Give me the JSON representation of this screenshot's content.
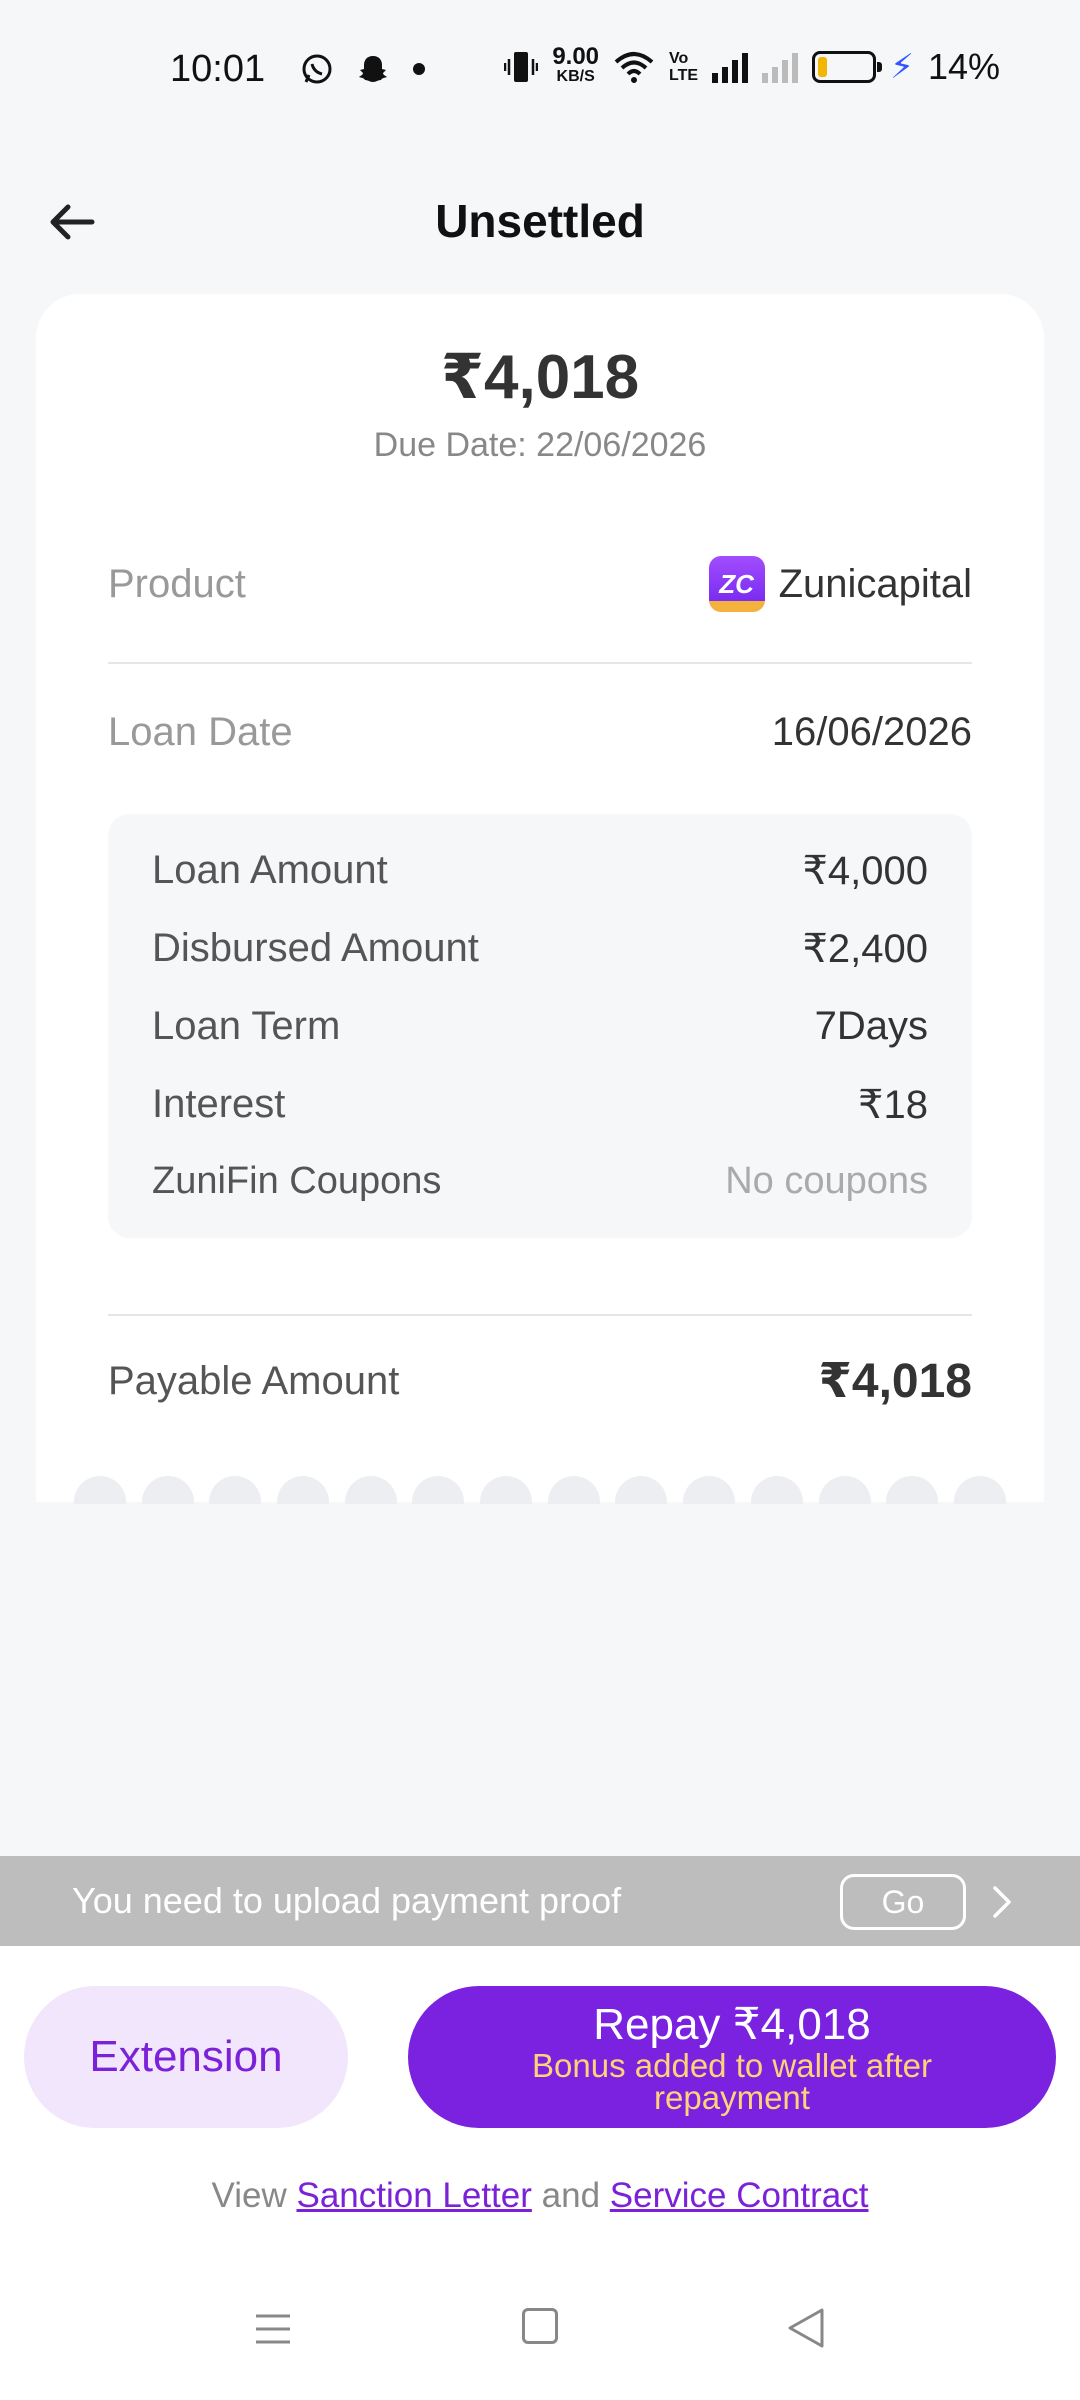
{
  "status_bar": {
    "time": "10:01",
    "net_speed_value": "9.00",
    "net_speed_unit": "KB/S",
    "lte_top": "Vo",
    "lte_bottom": "LTE",
    "battery_percent": "14%",
    "battery_level": 0.14
  },
  "header": {
    "title": "Unsettled"
  },
  "summary": {
    "amount": "₹4,018",
    "due_date": "Due Date: 22/06/2026"
  },
  "details": {
    "product_label": "Product",
    "product_logo_text": "ZC",
    "product_value": "Zunicapital",
    "loan_date_label": "Loan Date",
    "loan_date_value": "16/06/2026",
    "breakdown": [
      {
        "label": "Loan Amount",
        "value": "₹4,000"
      },
      {
        "label": "Disbursed Amount",
        "value": "₹2,400"
      },
      {
        "label": "Loan Term",
        "value": "7Days"
      },
      {
        "label": "Interest",
        "value": "₹18"
      },
      {
        "label": "ZuniFin Coupons",
        "value": "No coupons"
      }
    ],
    "payable_label": "Payable Amount",
    "payable_value": "₹4,018"
  },
  "proof_banner": {
    "text": "You need to upload payment proof",
    "go_label": "Go"
  },
  "actions": {
    "extension_label": "Extension",
    "repay_label": "Repay ₹4,018",
    "repay_sub": "Bonus added to wallet after repayment"
  },
  "contract": {
    "prefix": "View",
    "sanction_letter": "Sanction Letter",
    "and": "and",
    "service_contract": "Service Contract"
  },
  "colors": {
    "accent": "#7a22e0",
    "accent_light": "#f1e6fb",
    "bonus_text": "#ffd27a",
    "banner_bg": "#bdbdbd",
    "page_bg": "#f6f7f9"
  }
}
